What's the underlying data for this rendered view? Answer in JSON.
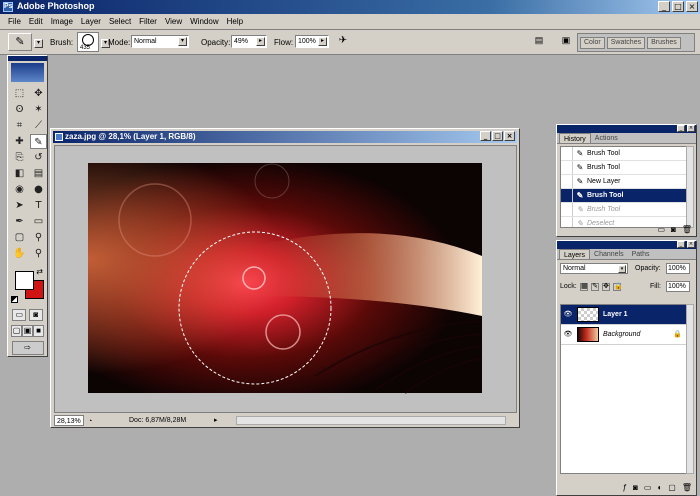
{
  "window": {
    "title": "Adobe Photoshop",
    "app_icon": "Ps",
    "controls": {
      "minimize": "_",
      "maximize": "□",
      "close": "×"
    }
  },
  "menu": [
    "File",
    "Edit",
    "Image",
    "Layer",
    "Select",
    "Filter",
    "View",
    "Window",
    "Help"
  ],
  "options_bar": {
    "tool_icon": "brush-icon",
    "brush_label": "Brush:",
    "brush_size": "435",
    "mode_label": "Mode:",
    "mode_value": "Normal",
    "opacity_label": "Opacity:",
    "opacity_value": "49%",
    "flow_label": "Flow:",
    "flow_value": "100%",
    "palette_well_tabs": [
      "Color",
      "Swatches",
      "Brushes"
    ]
  },
  "toolbox": {
    "tools": [
      "marquee-icon",
      "move-icon",
      "lasso-icon",
      "magic-wand-icon",
      "crop-icon",
      "slice-icon",
      "healing-brush-icon",
      "brush-icon",
      "clone-stamp-icon",
      "history-brush-icon",
      "eraser-icon",
      "gradient-icon",
      "blur-icon",
      "dodge-icon",
      "path-selection-icon",
      "type-icon",
      "pen-icon",
      "shape-icon",
      "notes-icon",
      "eyedropper-icon",
      "hand-icon",
      "zoom-icon"
    ],
    "tool_glyphs": [
      "⬚",
      "✥",
      "ʘ",
      "✶",
      "⌗",
      "⟋",
      "✚",
      "✎",
      "⎘",
      "↺",
      "◧",
      "▤",
      "◉",
      "●",
      "➤",
      "T",
      "✒",
      "▭",
      "▢",
      "⚲",
      "✋",
      "⚲"
    ],
    "foreground_color": "#ffffff",
    "background_color": "#d01414"
  },
  "document": {
    "title": "zaza.jpg @ 28,1% (Layer 1, RGB/8)",
    "zoom": "28,13%",
    "doc_info": "Doc: 6,87M/8,28M"
  },
  "history": {
    "tabs": [
      "History",
      "Actions"
    ],
    "items": [
      {
        "label": "Brush Tool",
        "state": "normal"
      },
      {
        "label": "Brush Tool",
        "state": "normal"
      },
      {
        "label": "New Layer",
        "state": "normal"
      },
      {
        "label": "Brush Tool",
        "state": "selected"
      },
      {
        "label": "Brush Tool",
        "state": "dimmed"
      },
      {
        "label": "Deselect",
        "state": "dimmed"
      }
    ]
  },
  "layers": {
    "tabs": [
      "Layers",
      "Channels",
      "Paths"
    ],
    "blend_mode": "Normal",
    "opacity_label": "Opacity:",
    "opacity": "100%",
    "lock_label": "Lock:",
    "fill_label": "Fill:",
    "fill": "100%",
    "items": [
      {
        "name": "Layer 1",
        "selected": true
      },
      {
        "name": "Background",
        "selected": false
      }
    ]
  }
}
